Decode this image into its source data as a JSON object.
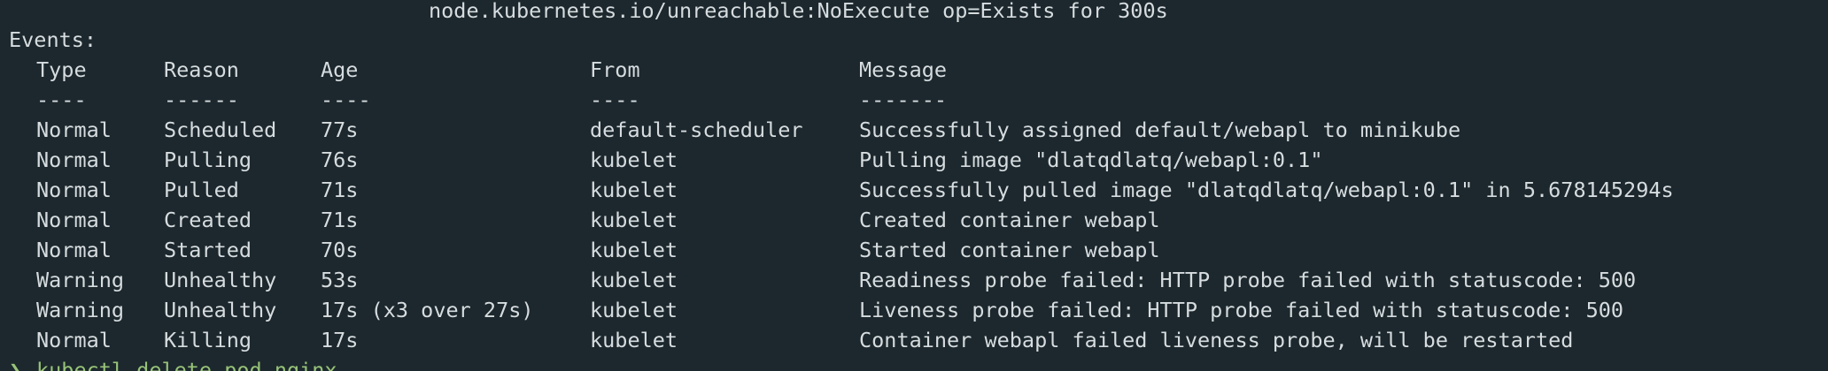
{
  "tolerations_line": "node.kubernetes.io/unreachable:NoExecute op=Exists for 300s",
  "events_label": "Events:",
  "headers": [
    "Type",
    "Reason",
    "Age",
    "From",
    "Message"
  ],
  "separators": [
    "----",
    "------",
    "----",
    "----",
    "-------"
  ],
  "events": [
    {
      "type": "Normal",
      "reason": "Scheduled",
      "age": "77s",
      "from": "default-scheduler",
      "message": "Successfully assigned default/webapl to minikube"
    },
    {
      "type": "Normal",
      "reason": "Pulling",
      "age": "76s",
      "from": "kubelet",
      "message": "Pulling image \"dlatqdlatq/webapl:0.1\""
    },
    {
      "type": "Normal",
      "reason": "Pulled",
      "age": "71s",
      "from": "kubelet",
      "message": "Successfully pulled image \"dlatqdlatq/webapl:0.1\" in 5.678145294s"
    },
    {
      "type": "Normal",
      "reason": "Created",
      "age": "71s",
      "from": "kubelet",
      "message": "Created container webapl"
    },
    {
      "type": "Normal",
      "reason": "Started",
      "age": "70s",
      "from": "kubelet",
      "message": "Started container webapl"
    },
    {
      "type": "Warning",
      "reason": "Unhealthy",
      "age": "53s",
      "from": "kubelet",
      "message": "Readiness probe failed: HTTP probe failed with statuscode: 500"
    },
    {
      "type": "Warning",
      "reason": "Unhealthy",
      "age": "17s (x3 over 27s)",
      "from": "kubelet",
      "message": "Liveness probe failed: HTTP probe failed with statuscode: 500"
    },
    {
      "type": "Normal",
      "reason": "Killing",
      "age": "17s",
      "from": "kubelet",
      "message": "Container webapl failed liveness probe, will be restarted"
    }
  ],
  "prompt": {
    "symbol": "❯",
    "command": "kubectl delete pod nginx"
  },
  "colors": {
    "background": "#1c282d",
    "foreground": "#d6dcdf",
    "prompt": "#98c379"
  }
}
